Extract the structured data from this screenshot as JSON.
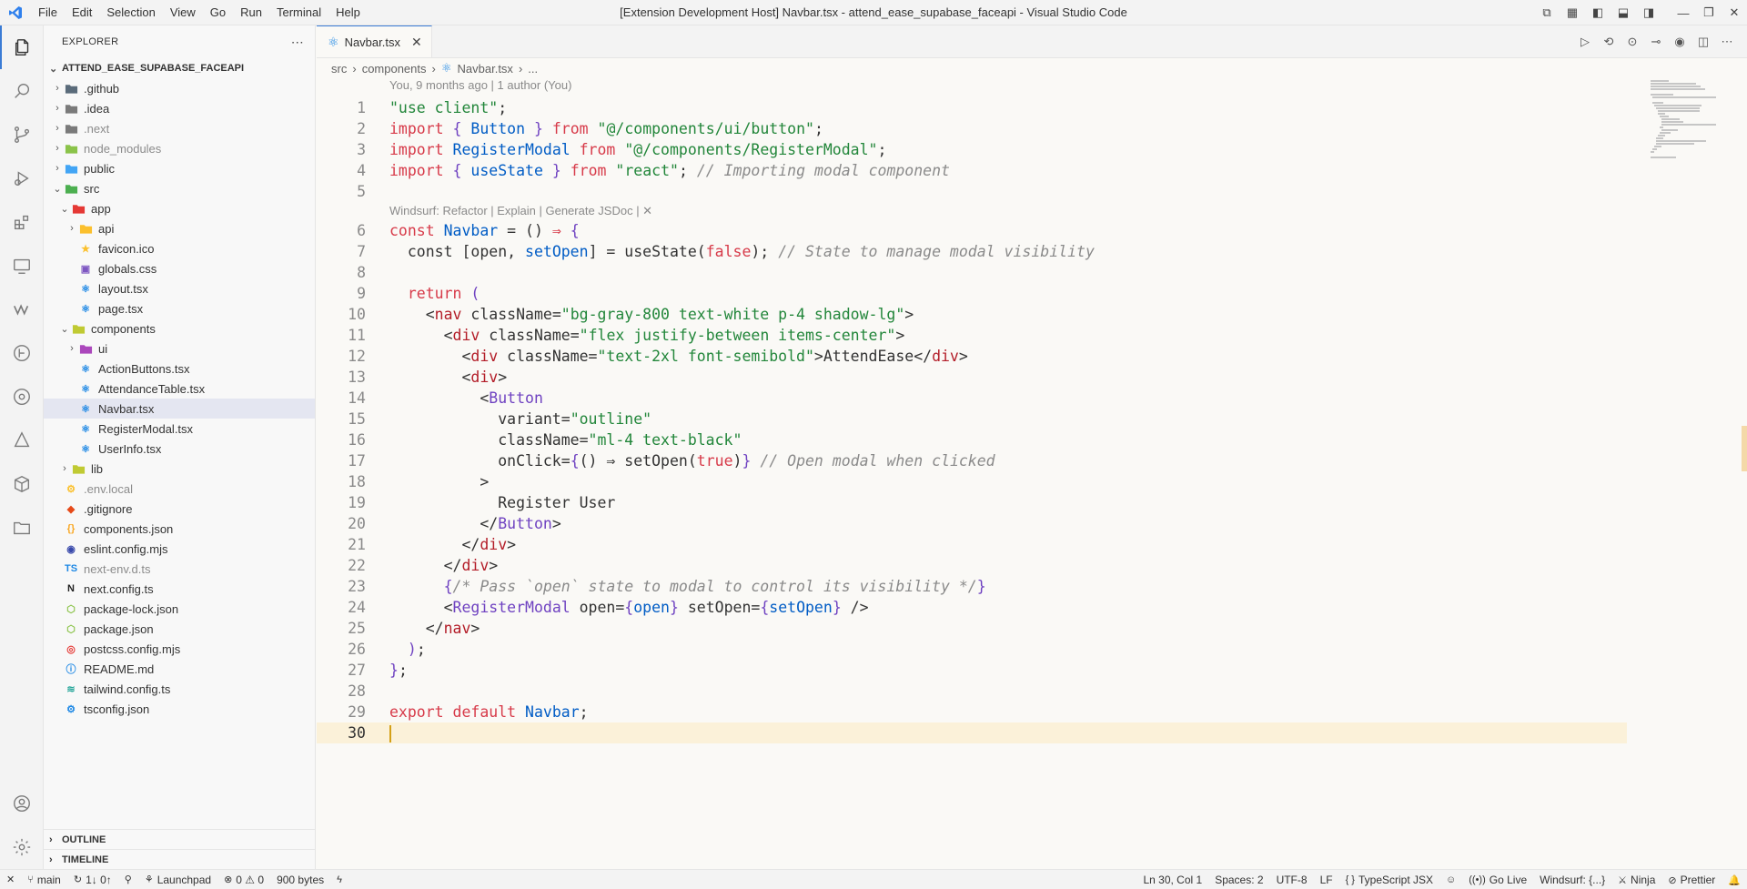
{
  "window": {
    "title": "[Extension Development Host] Navbar.tsx - attend_ease_supabase_faceapi - Visual Studio Code",
    "menu": [
      "File",
      "Edit",
      "Selection",
      "View",
      "Go",
      "Run",
      "Terminal",
      "Help"
    ]
  },
  "sidebar": {
    "title": "EXPLORER",
    "project": "ATTEND_EASE_SUPABASE_FACEAPI",
    "tree": [
      {
        "label": ".github",
        "depth": 1,
        "chevron": "›",
        "icon": "folder-icon",
        "color": "#5a6b7a"
      },
      {
        "label": ".idea",
        "depth": 1,
        "chevron": "›",
        "icon": "folder-icon",
        "color": "#7a7a7a"
      },
      {
        "label": ".next",
        "depth": 1,
        "chevron": "›",
        "icon": "folder-icon",
        "color": "#7a7a7a",
        "dim": true
      },
      {
        "label": "node_modules",
        "depth": 1,
        "chevron": "›",
        "icon": "folder-icon",
        "color": "#8bc34a",
        "dim": true
      },
      {
        "label": "public",
        "depth": 1,
        "chevron": "›",
        "icon": "folder-icon",
        "color": "#42a5f5"
      },
      {
        "label": "src",
        "depth": 1,
        "chevron": "⌄",
        "icon": "folder-icon",
        "color": "#4caf50"
      },
      {
        "label": "app",
        "depth": 2,
        "chevron": "⌄",
        "icon": "folder-icon",
        "color": "#e53935"
      },
      {
        "label": "api",
        "depth": 3,
        "chevron": "›",
        "icon": "folder-icon",
        "color": "#fbc02d"
      },
      {
        "label": "favicon.ico",
        "depth": 3,
        "chevron": "",
        "icon": "star-icon",
        "color": "#fbc02d"
      },
      {
        "label": "globals.css",
        "depth": 3,
        "chevron": "",
        "icon": "css-icon",
        "color": "#7e57c2"
      },
      {
        "label": "layout.tsx",
        "depth": 3,
        "chevron": "",
        "icon": "react-icon",
        "color": "#1e88e5"
      },
      {
        "label": "page.tsx",
        "depth": 3,
        "chevron": "",
        "icon": "react-icon",
        "color": "#1e88e5"
      },
      {
        "label": "components",
        "depth": 2,
        "chevron": "⌄",
        "icon": "folder-icon",
        "color": "#c0ca33"
      },
      {
        "label": "ui",
        "depth": 3,
        "chevron": "›",
        "icon": "folder-icon",
        "color": "#ab47bc"
      },
      {
        "label": "ActionButtons.tsx",
        "depth": 3,
        "chevron": "",
        "icon": "react-icon",
        "color": "#1e88e5"
      },
      {
        "label": "AttendanceTable.tsx",
        "depth": 3,
        "chevron": "",
        "icon": "react-icon",
        "color": "#1e88e5"
      },
      {
        "label": "Navbar.tsx",
        "depth": 3,
        "chevron": "",
        "icon": "react-icon",
        "color": "#1e88e5",
        "selected": true
      },
      {
        "label": "RegisterModal.tsx",
        "depth": 3,
        "chevron": "",
        "icon": "react-icon",
        "color": "#1e88e5"
      },
      {
        "label": "UserInfo.tsx",
        "depth": 3,
        "chevron": "",
        "icon": "react-icon",
        "color": "#1e88e5"
      },
      {
        "label": "lib",
        "depth": 2,
        "chevron": "›",
        "icon": "folder-icon",
        "color": "#c0ca33"
      },
      {
        "label": ".env.local",
        "depth": 1,
        "chevron": "",
        "icon": "env-icon",
        "color": "#fbc02d",
        "dim": true
      },
      {
        "label": ".gitignore",
        "depth": 1,
        "chevron": "",
        "icon": "git-icon",
        "color": "#e64a19"
      },
      {
        "label": "components.json",
        "depth": 1,
        "chevron": "",
        "icon": "json-icon",
        "color": "#f9a825"
      },
      {
        "label": "eslint.config.mjs",
        "depth": 1,
        "chevron": "",
        "icon": "eslint-icon",
        "color": "#3949ab"
      },
      {
        "label": "next-env.d.ts",
        "depth": 1,
        "chevron": "",
        "icon": "ts-icon",
        "color": "#1e88e5",
        "dim": true
      },
      {
        "label": "next.config.ts",
        "depth": 1,
        "chevron": "",
        "icon": "next-icon",
        "color": "#222222"
      },
      {
        "label": "package-lock.json",
        "depth": 1,
        "chevron": "",
        "icon": "npm-icon",
        "color": "#8bc34a"
      },
      {
        "label": "package.json",
        "depth": 1,
        "chevron": "",
        "icon": "npm-icon",
        "color": "#8bc34a"
      },
      {
        "label": "postcss.config.mjs",
        "depth": 1,
        "chevron": "",
        "icon": "postcss-icon",
        "color": "#e53935"
      },
      {
        "label": "README.md",
        "depth": 1,
        "chevron": "",
        "icon": "info-icon",
        "color": "#1e88e5"
      },
      {
        "label": "tailwind.config.ts",
        "depth": 1,
        "chevron": "",
        "icon": "tailwind-icon",
        "color": "#26a69a"
      },
      {
        "label": "tsconfig.json",
        "depth": 1,
        "chevron": "",
        "icon": "tsconfig-icon",
        "color": "#1e88e5"
      }
    ],
    "outline": "OUTLINE",
    "timeline": "TIMELINE"
  },
  "editor": {
    "tab": "Navbar.tsx",
    "breadcrumb": [
      "src",
      "components",
      "Navbar.tsx",
      "..."
    ],
    "blame": "You, 9 months ago | 1 author (You)",
    "codelens": "Windsurf: Refactor | Explain | Generate JSDoc | ✕",
    "current_line": 30,
    "lines": [
      [
        [
          "str",
          "\"use client\""
        ],
        [
          "",
          ";"
        ]
      ],
      [
        [
          "kw",
          "import"
        ],
        [
          "",
          " "
        ],
        [
          "brace",
          "{"
        ],
        [
          "",
          " "
        ],
        [
          "var",
          "Button"
        ],
        [
          "",
          " "
        ],
        [
          "brace",
          "}"
        ],
        [
          "",
          " "
        ],
        [
          "kw",
          "from"
        ],
        [
          "",
          " "
        ],
        [
          "str",
          "\"@/components/ui/button\""
        ],
        [
          "",
          ";"
        ]
      ],
      [
        [
          "kw",
          "import"
        ],
        [
          "",
          " "
        ],
        [
          "var",
          "RegisterModal"
        ],
        [
          "",
          " "
        ],
        [
          "kw",
          "from"
        ],
        [
          "",
          " "
        ],
        [
          "str",
          "\"@/components/RegisterModal\""
        ],
        [
          "",
          ";"
        ]
      ],
      [
        [
          "kw",
          "import"
        ],
        [
          "",
          " "
        ],
        [
          "brace",
          "{"
        ],
        [
          "",
          " "
        ],
        [
          "var",
          "useState"
        ],
        [
          "",
          " "
        ],
        [
          "brace",
          "}"
        ],
        [
          "",
          " "
        ],
        [
          "kw",
          "from"
        ],
        [
          "",
          " "
        ],
        [
          "str",
          "\"react\""
        ],
        [
          "",
          "; "
        ],
        [
          "com",
          "// Importing modal component"
        ]
      ],
      [],
      [
        [
          "kw",
          "const"
        ],
        [
          "",
          " "
        ],
        [
          "var",
          "Navbar"
        ],
        [
          "",
          " = () "
        ],
        [
          "kw",
          "⇒"
        ],
        [
          "",
          " "
        ],
        [
          "brace",
          "{"
        ]
      ],
      [
        [
          "",
          "  const [open, "
        ],
        [
          "var",
          "setOpen"
        ],
        [
          "",
          "] = useState("
        ],
        [
          "kw",
          "false"
        ],
        [
          "",
          "); "
        ],
        [
          "com",
          "// State to manage modal visibility"
        ]
      ],
      [],
      [
        [
          "",
          "  "
        ],
        [
          "kw",
          "return"
        ],
        [
          "",
          " "
        ],
        [
          "brace",
          "("
        ]
      ],
      [
        [
          "",
          "    <"
        ],
        [
          "tag",
          "nav"
        ],
        [
          "",
          " className="
        ],
        [
          "str",
          "\"bg-gray-800 text-white p-4 shadow-lg\""
        ],
        [
          "",
          ">"
        ]
      ],
      [
        [
          "",
          "      <"
        ],
        [
          "tag",
          "div"
        ],
        [
          "",
          " className="
        ],
        [
          "str",
          "\"flex justify-between items-center\""
        ],
        [
          "",
          ">"
        ]
      ],
      [
        [
          "",
          "        <"
        ],
        [
          "tag",
          "div"
        ],
        [
          "",
          " className="
        ],
        [
          "str",
          "\"text-2xl font-semibold\""
        ],
        [
          "",
          ">AttendEase</"
        ],
        [
          "tag",
          "div"
        ],
        [
          "",
          ">"
        ]
      ],
      [
        [
          "",
          "        <"
        ],
        [
          "tag",
          "div"
        ],
        [
          "",
          ">"
        ]
      ],
      [
        [
          "",
          "          <"
        ],
        [
          "brace",
          "Button"
        ]
      ],
      [
        [
          "",
          "            variant="
        ],
        [
          "str",
          "\"outline\""
        ]
      ],
      [
        [
          "",
          "            className="
        ],
        [
          "str",
          "\"ml-4 text-black\""
        ]
      ],
      [
        [
          "",
          "            onClick="
        ],
        [
          "brace",
          "{"
        ],
        [
          "",
          "() ⇒ setOpen("
        ],
        [
          "kw",
          "true"
        ],
        [
          "",
          ")"
        ],
        [
          "brace",
          "}"
        ],
        [
          "",
          " "
        ],
        [
          "com",
          "// Open modal when clicked"
        ]
      ],
      [
        [
          "",
          "          >"
        ]
      ],
      [
        [
          "",
          "            Register User"
        ]
      ],
      [
        [
          "",
          "          </"
        ],
        [
          "brace",
          "Button"
        ],
        [
          "",
          ">"
        ]
      ],
      [
        [
          "",
          "        </"
        ],
        [
          "tag",
          "div"
        ],
        [
          "",
          ">"
        ]
      ],
      [
        [
          "",
          "      </"
        ],
        [
          "tag",
          "div"
        ],
        [
          "",
          ">"
        ]
      ],
      [
        [
          "",
          "      "
        ],
        [
          "brace",
          "{"
        ],
        [
          "com",
          "/* Pass `open` state to modal to control its visibility */"
        ],
        [
          "brace",
          "}"
        ]
      ],
      [
        [
          "",
          "      <"
        ],
        [
          "brace",
          "RegisterModal"
        ],
        [
          "",
          " open="
        ],
        [
          "brace",
          "{"
        ],
        [
          "var",
          "open"
        ],
        [
          "brace",
          "}"
        ],
        [
          "",
          " setOpen="
        ],
        [
          "brace",
          "{"
        ],
        [
          "var",
          "setOpen"
        ],
        [
          "brace",
          "}"
        ],
        [
          "",
          " />"
        ]
      ],
      [
        [
          "",
          "    </"
        ],
        [
          "tag",
          "nav"
        ],
        [
          "",
          ">"
        ]
      ],
      [
        [
          "",
          "  "
        ],
        [
          "brace",
          ")"
        ],
        [
          "",
          ";"
        ]
      ],
      [
        [
          "brace",
          "}"
        ],
        [
          "",
          ";"
        ]
      ],
      [],
      [
        [
          "kw",
          "export"
        ],
        [
          "",
          " "
        ],
        [
          "kw",
          "default"
        ],
        [
          "",
          " "
        ],
        [
          "var",
          "Navbar"
        ],
        [
          "",
          ";"
        ]
      ],
      []
    ]
  },
  "statusbar": {
    "left": [
      {
        "label": "",
        "icon": "remote-icon"
      },
      {
        "label": "main",
        "icon": "branch-icon"
      },
      {
        "label": "1↓ 0↑",
        "icon": "sync-icon"
      },
      {
        "label": "",
        "icon": "debug-icon"
      },
      {
        "label": "Launchpad",
        "icon": "launchpad-icon"
      },
      {
        "label": "0 ⚠ 0",
        "icon": "error-icon"
      },
      {
        "label": "900 bytes",
        "icon": ""
      },
      {
        "label": "",
        "icon": "bolt-icon"
      }
    ],
    "right": [
      {
        "label": "Ln 30, Col 1",
        "icon": ""
      },
      {
        "label": "Spaces: 2",
        "icon": ""
      },
      {
        "label": "UTF-8",
        "icon": ""
      },
      {
        "label": "LF",
        "icon": ""
      },
      {
        "label": "TypeScript JSX",
        "icon": "braces-icon"
      },
      {
        "label": "",
        "icon": "copilot-icon"
      },
      {
        "label": "Go Live",
        "icon": "broadcast-icon"
      },
      {
        "label": "Windsurf: {...}",
        "icon": ""
      },
      {
        "label": "Ninja",
        "icon": "ninja-icon"
      },
      {
        "label": "Prettier",
        "icon": "prettier-icon"
      },
      {
        "label": "",
        "icon": "bell-icon"
      }
    ]
  }
}
